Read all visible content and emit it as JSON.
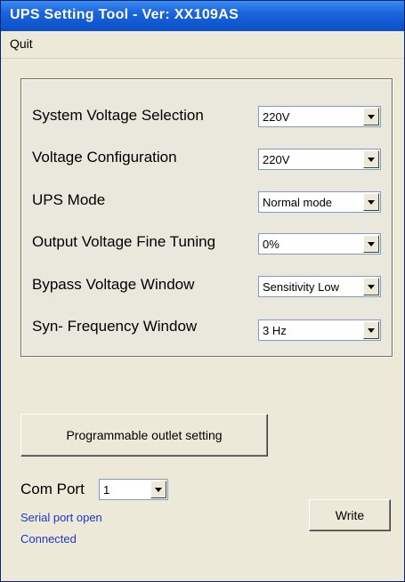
{
  "window": {
    "title": "UPS Setting Tool - Ver: XX109AS"
  },
  "menu": {
    "quit": "Quit"
  },
  "settings": [
    {
      "label": "System Voltage Selection",
      "value": "220V"
    },
    {
      "label": "Voltage Configuration",
      "value": "220V"
    },
    {
      "label": "UPS Mode",
      "value": "Normal mode"
    },
    {
      "label": "Output Voltage Fine Tuning",
      "value": "0%"
    },
    {
      "label": "Bypass Voltage Window",
      "value": "Sensitivity Low"
    },
    {
      "label": "Syn- Frequency Window",
      "value": "3 Hz"
    }
  ],
  "outlet_button": "Programmable outlet setting",
  "com_port": {
    "label": "Com Port",
    "value": "1"
  },
  "status": {
    "port": "Serial port open",
    "connection": "Connected"
  },
  "write_button": "Write",
  "colors": {
    "titlebar": "#1a64dc",
    "status_text": "#1f36c9",
    "window_bg": "#ece9d8"
  }
}
